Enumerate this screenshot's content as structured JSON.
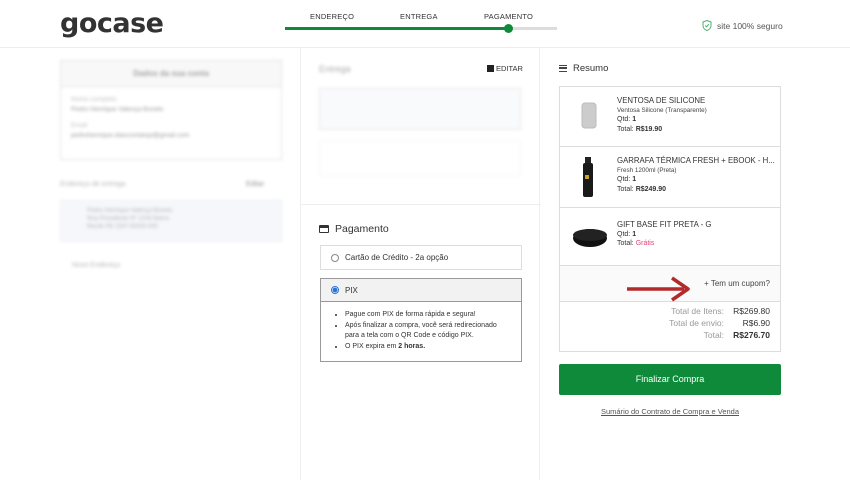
{
  "header": {
    "logo": "gocase",
    "steps": [
      "ENDEREÇO",
      "ENTREGA",
      "PAGAMENTO"
    ],
    "progress_fraction": 0.82,
    "secure_text": "site 100% seguro"
  },
  "left": {
    "account_title": "Dados da sua conta",
    "name_label": "Nome completo",
    "name_value": "Pedro Henrique Valença Bonelo",
    "email_label": "Email",
    "email_value": "pedrohenrique.diascontatopi@gmail.com",
    "delivery_label": "Endereço de entrega",
    "delivery_action": "Editar",
    "address_lines": [
      "Pedro Henrique Valença Bonelo",
      "Rua Presidente Nº 1234 Bairro",
      "Recife PE CEP 50000-000"
    ],
    "new_address": "Novo Endereço"
  },
  "middle": {
    "edit_label": "EDITAR",
    "delivery_title": "Entrega",
    "payment_title": "Pagamento",
    "credit_option": "Cartão de Crédito - 2a opção",
    "pix_option": "PIX",
    "pix_items": [
      "Pague com PIX de forma rápida e segura!",
      "Após finalizar a compra, você será redirecionado para a tela com o QR Code e código PIX.",
      "O PIX expira em "
    ],
    "pix_expire": "2 horas."
  },
  "summary": {
    "title": "Resumo",
    "items": [
      {
        "name": "VENTOSA DE SILICONE",
        "variant": "Ventosa Silicone (Transparente)",
        "qty_label": "Qtd:",
        "qty": "1",
        "total_label": "Total:",
        "total": "R$19.90"
      },
      {
        "name": "GARRAFA TÉRMICA FRESH + EBOOK - H...",
        "variant": "Fresh 1200ml (Preta)",
        "qty_label": "Qtd:",
        "qty": "1",
        "total_label": "Total:",
        "total": "R$249.90"
      },
      {
        "name": "GIFT BASE FIT PRETA - G",
        "variant": "",
        "qty_label": "Qtd:",
        "qty": "1",
        "total_label": "Total:",
        "total": "Grátis"
      }
    ],
    "coupon": "+ Tem um cupom?",
    "items_total_label": "Total de Itens:",
    "items_total": "R$269.80",
    "shipping_label": "Total de envio:",
    "shipping": "R$6.90",
    "grand_label": "Total:",
    "grand_total": "R$276.70",
    "finish_button": "Finalizar Compra",
    "contract_link": "Sumário do Contrato de Compra e Venda"
  },
  "colors": {
    "accent_green": "#0f8a3a",
    "free_pink": "#e0457b",
    "arrow_red": "#b22a2a"
  }
}
